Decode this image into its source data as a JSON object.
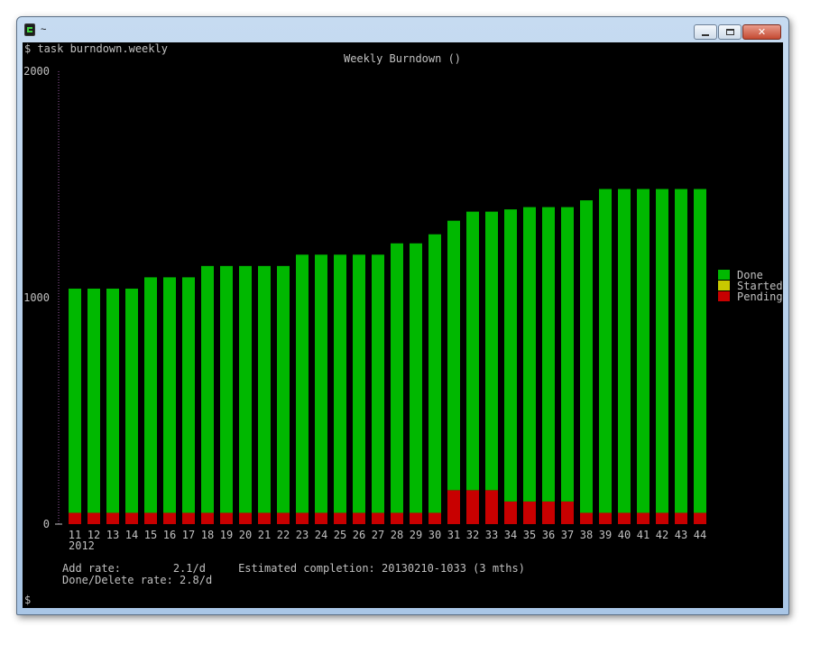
{
  "window": {
    "title": "~",
    "minimize_icon": "minimize-icon",
    "maximize_icon": "maximize-icon",
    "close_icon": "close-icon",
    "close_glyph": "✕"
  },
  "terminal": {
    "command_line": "$ task burndown.weekly",
    "add_rate_line": "Add rate:        2.1/d     Estimated completion: 20130210-1033 (3 mths)",
    "done_rate_line": "Done/Delete rate: 2.8/d",
    "prompt_line": "$"
  },
  "chart_data": {
    "type": "bar",
    "title": "Weekly Burndown ()",
    "stacked": true,
    "categories": [
      "11",
      "12",
      "13",
      "14",
      "15",
      "16",
      "17",
      "18",
      "19",
      "20",
      "21",
      "22",
      "23",
      "24",
      "25",
      "26",
      "27",
      "28",
      "29",
      "30",
      "31",
      "32",
      "33",
      "34",
      "35",
      "36",
      "37",
      "38",
      "39",
      "40",
      "41",
      "42",
      "43",
      "44"
    ],
    "year_label": "2012",
    "y_ticks": [
      "0",
      "1000",
      "2000"
    ],
    "ylim": [
      0,
      2000
    ],
    "series": [
      {
        "name": "Done",
        "color": "#00b800",
        "values": [
          990,
          990,
          990,
          990,
          1040,
          1040,
          1040,
          1090,
          1090,
          1090,
          1090,
          1090,
          1140,
          1140,
          1140,
          1140,
          1140,
          1190,
          1190,
          1230,
          1190,
          1230,
          1230,
          1290,
          1300,
          1300,
          1300,
          1380,
          1430,
          1430,
          1430,
          1430,
          1430,
          1430
        ]
      },
      {
        "name": "Started",
        "color": "#c8c800",
        "values": [
          0,
          0,
          0,
          0,
          0,
          0,
          0,
          0,
          0,
          0,
          0,
          0,
          0,
          0,
          0,
          0,
          0,
          0,
          0,
          0,
          0,
          0,
          0,
          0,
          0,
          0,
          0,
          0,
          0,
          0,
          0,
          0,
          0,
          0
        ]
      },
      {
        "name": "Pending",
        "color": "#c80000",
        "values": [
          50,
          50,
          50,
          50,
          50,
          50,
          50,
          50,
          50,
          50,
          50,
          50,
          50,
          50,
          50,
          50,
          50,
          50,
          50,
          50,
          150,
          150,
          150,
          100,
          100,
          100,
          100,
          50,
          50,
          50,
          50,
          50,
          50,
          50
        ]
      }
    ],
    "legend_position": "right",
    "grid": false
  }
}
